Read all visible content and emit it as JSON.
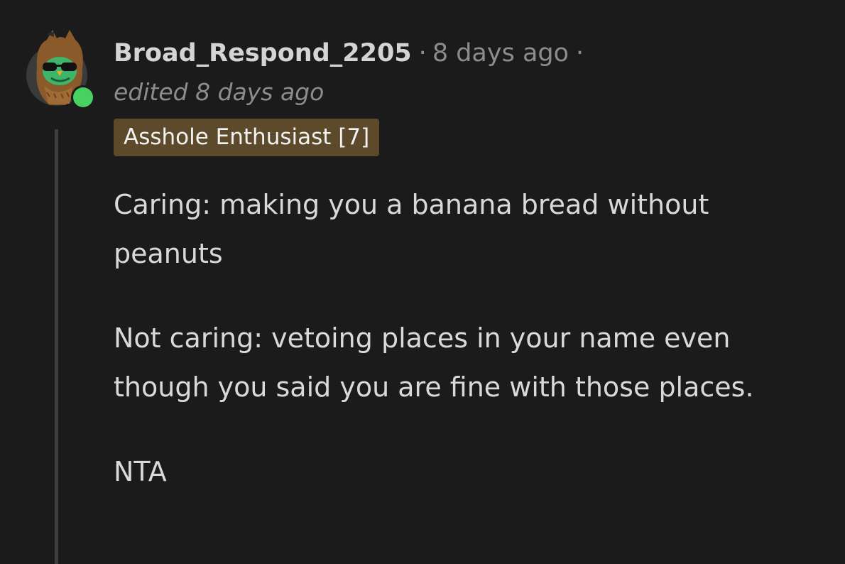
{
  "comment": {
    "username": "Broad_Respond_2205",
    "separator": "·",
    "timestamp": "8 days ago",
    "trailing_separator": "·",
    "edited": "edited 8 days ago",
    "flair": "Asshole Enthusiast [7]",
    "paragraphs": [
      "Caring: making you a banana bread without peanuts",
      "Not caring: vetoing places in your name even though you said you are fine with those places.",
      "NTA"
    ]
  },
  "colors": {
    "background": "#1b1b1b",
    "flair_background": "#5d4a2b",
    "online_indicator": "#46d160",
    "avatar_character": "#3fb56b"
  },
  "icons": {
    "avatar": "owl-costume-avatar-icon",
    "online_status": "online-status-dot-icon"
  }
}
